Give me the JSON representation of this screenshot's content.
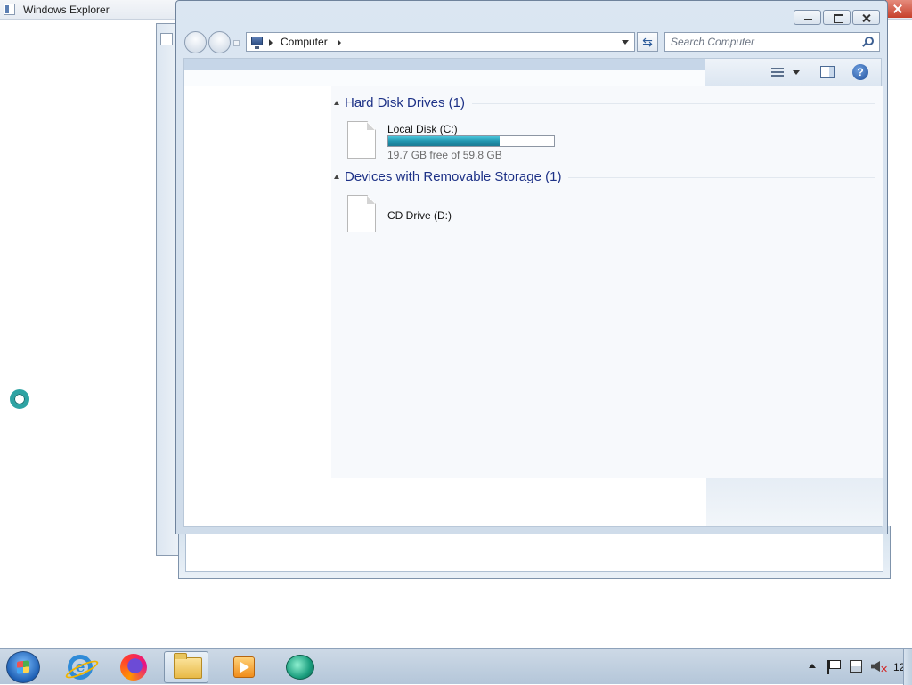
{
  "background_window": {
    "title": "Windows Explorer"
  },
  "explorer": {
    "address": {
      "breadcrumb": [
        "Computer"
      ]
    },
    "search": {
      "placeholder": "Search Computer"
    },
    "toolbar": {
      "help_label": "?"
    },
    "groups": [
      {
        "title": "Hard Disk Drives (1)",
        "items": [
          {
            "name": "Local Disk (C:)",
            "usage_fraction": 0.67,
            "space_text": "19.7 GB free of 59.8 GB"
          }
        ]
      },
      {
        "title": "Devices with Removable Storage (1)",
        "items": [
          {
            "name": "CD Drive (D:)"
          }
        ]
      }
    ]
  },
  "taskbar": {
    "apps": [
      "internet-explorer-icon",
      "firefox-icon",
      "windows-explorer-icon",
      "media-player-icon",
      "teal-app-icon"
    ],
    "clock_text": "12"
  },
  "colors": {
    "disk_bar_fill": "#1f93ad",
    "group_title": "#1e3287",
    "close_button": "#c6402b"
  }
}
